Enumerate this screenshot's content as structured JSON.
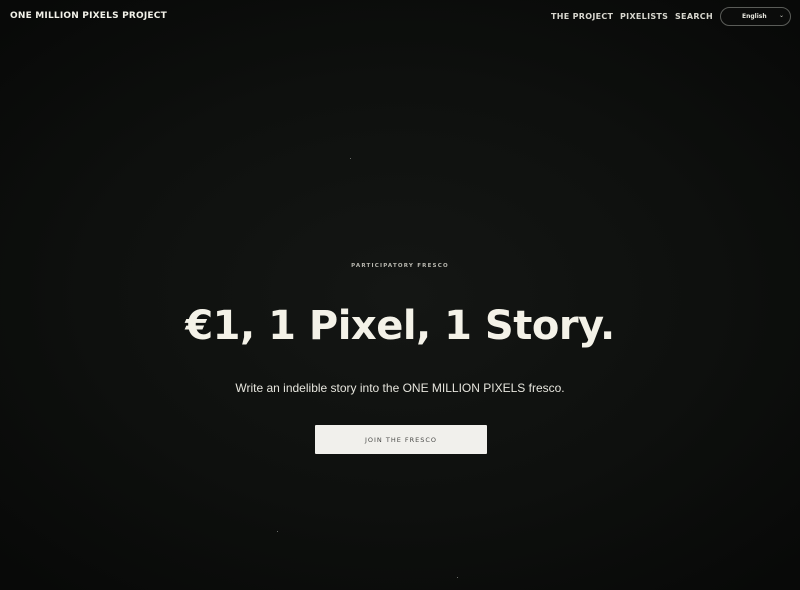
{
  "header": {
    "logo": "ONE MILLION PIXELS PROJECT",
    "nav": [
      {
        "label": "THE PROJECT"
      },
      {
        "label": "PIXELISTS"
      },
      {
        "label": "SEARCH"
      }
    ],
    "language": {
      "selected": "English"
    }
  },
  "hero": {
    "eyebrow": "PARTICIPATORY FRESCO",
    "headline": "€1, 1 Pixel, 1 Story.",
    "subline": "Write an indelible story into the ONE MILLION PIXELS fresco.",
    "cta_label": "JOIN THE FRESCO"
  },
  "colors": {
    "background": "#0a0b0a",
    "text": "#f4f2e8",
    "button_bg": "#f1f0ec",
    "button_text": "#4a4a48"
  }
}
